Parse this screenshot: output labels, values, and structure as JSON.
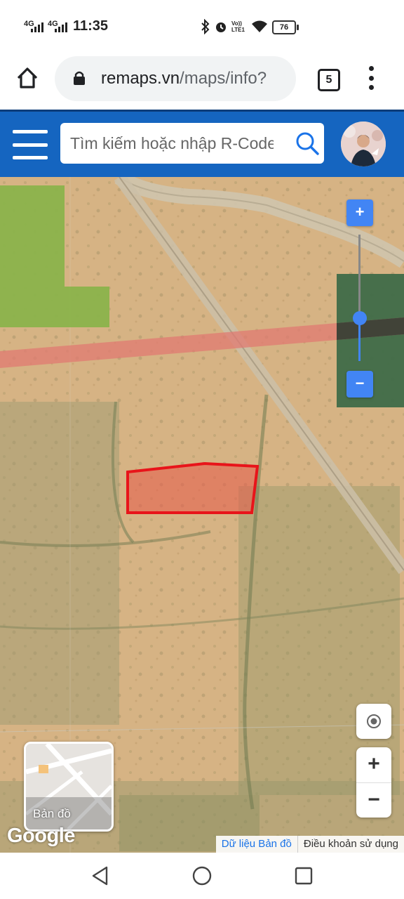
{
  "status_bar": {
    "network_1": "4G",
    "network_2": "4G",
    "time": "11:35",
    "volte": "Vo)) LTE1",
    "battery": "76"
  },
  "browser": {
    "url_host": "remaps.vn",
    "url_path": "/maps/info?",
    "tab_count": "5"
  },
  "app_header": {
    "search_placeholder": "Tìm kiếm hoặc nhập R-Code"
  },
  "map": {
    "zoom_in_label": "+",
    "zoom_out_label": "−",
    "slider_zoom_in_label": "+",
    "slider_zoom_out_label": "−",
    "zoom_level_fraction": 0.66,
    "map_type_label": "Bản đồ",
    "google_logo": "Google",
    "attribution_data": "Dữ liệu Bản đồ",
    "attribution_terms": "Điều khoản sử dụng",
    "highlight_color": "#e8141a",
    "accent_color": "#4285f4"
  },
  "colors": {
    "header_bg": "#1565c0"
  },
  "icons": [
    "home-icon",
    "lock-icon",
    "kebab-menu-icon",
    "hamburger-icon",
    "search-icon",
    "my-location-icon",
    "back-icon",
    "home-nav-icon",
    "recents-icon",
    "bluetooth-icon",
    "alarm-icon",
    "wifi-icon"
  ]
}
